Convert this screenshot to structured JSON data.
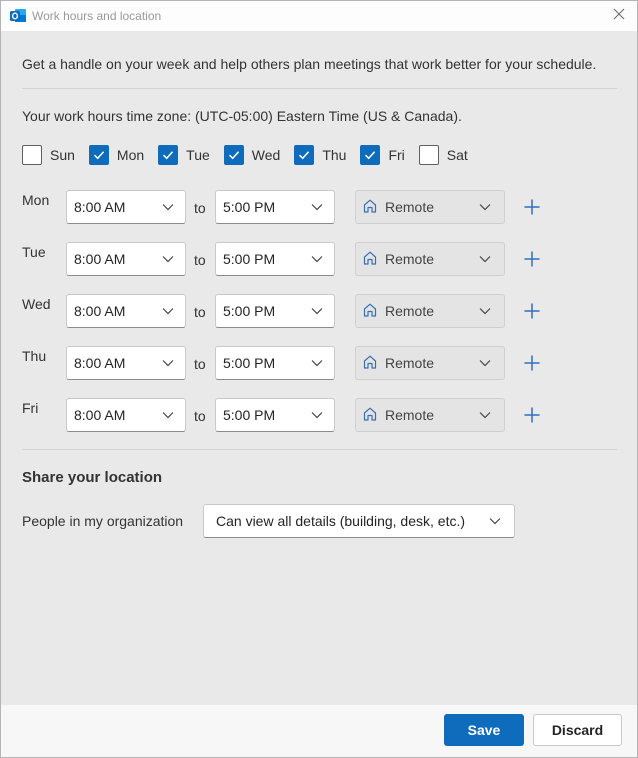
{
  "window": {
    "title": "Work hours and location"
  },
  "intro": "Get a handle on your week and help others plan meetings that work better for your schedule.",
  "timezone_text": "Your work hours time zone: (UTC-05:00) Eastern Time (US & Canada).",
  "days": [
    {
      "label": "Sun",
      "checked": false
    },
    {
      "label": "Mon",
      "checked": true
    },
    {
      "label": "Tue",
      "checked": true
    },
    {
      "label": "Wed",
      "checked": true
    },
    {
      "label": "Thu",
      "checked": true
    },
    {
      "label": "Fri",
      "checked": true
    },
    {
      "label": "Sat",
      "checked": false
    }
  ],
  "schedule": [
    {
      "day": "Mon",
      "start": "8:00 AM",
      "to": "to",
      "end": "5:00 PM",
      "location": "Remote"
    },
    {
      "day": "Tue",
      "start": "8:00 AM",
      "to": "to",
      "end": "5:00 PM",
      "location": "Remote"
    },
    {
      "day": "Wed",
      "start": "8:00 AM",
      "to": "to",
      "end": "5:00 PM",
      "location": "Remote"
    },
    {
      "day": "Thu",
      "start": "8:00 AM",
      "to": "to",
      "end": "5:00 PM",
      "location": "Remote"
    },
    {
      "day": "Fri",
      "start": "8:00 AM",
      "to": "to",
      "end": "5:00 PM",
      "location": "Remote"
    }
  ],
  "share": {
    "title": "Share your location",
    "label": "People in my organization",
    "value": "Can view all details (building, desk, etc.)"
  },
  "footer": {
    "save_label": "Save",
    "discard_label": "Discard"
  },
  "colors": {
    "accent": "#0f6cbd",
    "app_icon": "#0f6cbd"
  },
  "icons": {
    "app": "outlook-icon",
    "close": "close-icon",
    "chevron": "chevron-down-icon",
    "home": "home-icon",
    "add": "plus-icon",
    "check": "checkmark-icon"
  }
}
